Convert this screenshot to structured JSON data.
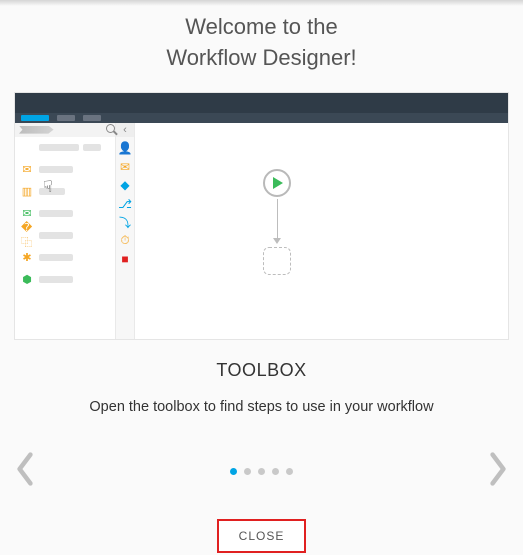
{
  "welcome": {
    "line1": "Welcome to the",
    "line2": "Workflow Designer!"
  },
  "section": {
    "title": "TOOLBOX",
    "description": "Open the toolbox to find steps to use in your workflow"
  },
  "close_label": "CLOSE",
  "pager": {
    "total": 5,
    "active_index": 0
  },
  "toolbox_icons": [
    {
      "name": "user-check-icon",
      "glyph": "👤",
      "color": "#9aa0a6"
    },
    {
      "name": "mail-icon",
      "glyph": "✉",
      "color": "#f5a623"
    },
    {
      "name": "diamond-icon",
      "glyph": "◆",
      "color": "#00a4e4"
    },
    {
      "name": "branch-icon",
      "glyph": "⎇",
      "color": "#00a4e4"
    },
    {
      "name": "merge-icon",
      "glyph": "⤵",
      "color": "#00a4e4"
    },
    {
      "name": "timer-icon",
      "glyph": "⏱",
      "color": "#f5a623"
    },
    {
      "name": "stop-icon",
      "glyph": "■",
      "color": "#e02020"
    }
  ],
  "left_items": [
    {
      "icon": "",
      "color": "",
      "width_class": "two"
    },
    {
      "icon": "✉",
      "color": "#f5a623",
      "width_class": "short"
    },
    {
      "icon": "▥",
      "color": "#f5a623",
      "width_class": "shorter"
    },
    {
      "icon": "✉",
      "color": "#3bbb5a",
      "width_class": "short"
    },
    {
      "icon": "�⿻",
      "color": "#f5a623",
      "width_class": "short"
    },
    {
      "icon": "✱",
      "color": "#f5a623",
      "width_class": "short"
    },
    {
      "icon": "⬢",
      "color": "#3bbb5a",
      "width_class": "short"
    }
  ]
}
